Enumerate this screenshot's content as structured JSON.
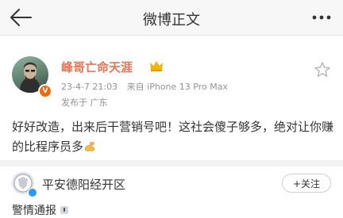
{
  "nav": {
    "title": "微博正文",
    "back_icon": "back-arrow-icon",
    "more_icon": "more-dots-icon"
  },
  "post": {
    "author": "峰哥亡命天涯",
    "time": "23-4-7 21:03",
    "source": "来自 iPhone 13 Pro Max",
    "location": "发布于 广东",
    "text": "好好改造，出来后干营销号吧！这社会傻子够多，绝对让你赚的比程序员多",
    "accent_color": "#eb7350"
  },
  "repost": {
    "author": "平安德阳经开区",
    "follow_label": "+关注",
    "text_preview": "警情通报"
  }
}
